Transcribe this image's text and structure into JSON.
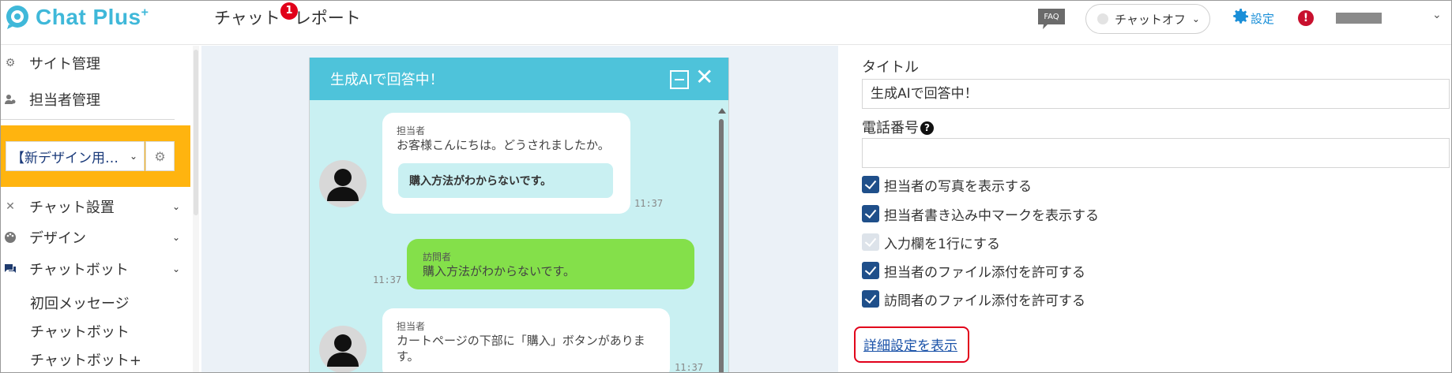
{
  "header": {
    "logo_text": "Chat Plus",
    "logo_sup": "+",
    "nav": [
      {
        "label": "チャット",
        "badge": "1"
      },
      {
        "label": "レポート"
      }
    ],
    "faq_label": "FAQ",
    "chat_status": "チャットオフ",
    "settings_label": "設定",
    "alert_symbol": "!"
  },
  "sidebar": {
    "items": [
      {
        "label": "サイト管理",
        "icon": "gear-icon"
      },
      {
        "label": "担当者管理",
        "icon": "users-gear-icon"
      }
    ],
    "site_select_value": "【新デザイン用…",
    "sections": [
      {
        "label": "チャット設置",
        "icon": "tools-icon"
      },
      {
        "label": "デザイン",
        "icon": "palette-icon"
      },
      {
        "label": "チャットボット",
        "icon": "chat-bubbles-icon"
      }
    ],
    "subitems": [
      "初回メッセージ",
      "チャットボット",
      "チャットボット+"
    ]
  },
  "preview": {
    "title": "生成AIで回答中！",
    "messages": [
      {
        "role": "agent",
        "sender": "担当者",
        "text": "お客様こんにちは。どうされましたか。",
        "choice": "購入方法がわからないです。",
        "time": "11:37"
      },
      {
        "role": "visitor",
        "sender": "訪問者",
        "text": "購入方法がわからないです。",
        "time": "11:37"
      },
      {
        "role": "agent",
        "sender": "担当者",
        "text_line1": "カートページの下部に「購入」ボタンがありま",
        "text_line2": "す。",
        "time": "11:37"
      }
    ]
  },
  "form": {
    "title_label": "タイトル",
    "title_value": "生成AIで回答中！",
    "phone_label": "電話番号",
    "phone_value": "",
    "checkboxes": [
      {
        "label": "担当者の写真を表示する",
        "checked": true,
        "disabled": false
      },
      {
        "label": "担当者書き込み中マークを表示する",
        "checked": true,
        "disabled": false
      },
      {
        "label": "入力欄を1行にする",
        "checked": true,
        "disabled": true
      },
      {
        "label": "担当者のファイル添付を許可する",
        "checked": true,
        "disabled": false
      },
      {
        "label": "訪問者のファイル添付を許可する",
        "checked": true,
        "disabled": false
      }
    ],
    "advanced_link": "詳細設定を表示"
  },
  "colors": {
    "brand": "#3fb8d9",
    "widget_header": "#4ec3da",
    "widget_bg": "#c9f0f2",
    "visitor_bubble": "#84e04a",
    "highlight": "#ffb40f",
    "checkbox": "#1f4f8a",
    "link": "#1a52a8",
    "alert": "#e1001a"
  }
}
